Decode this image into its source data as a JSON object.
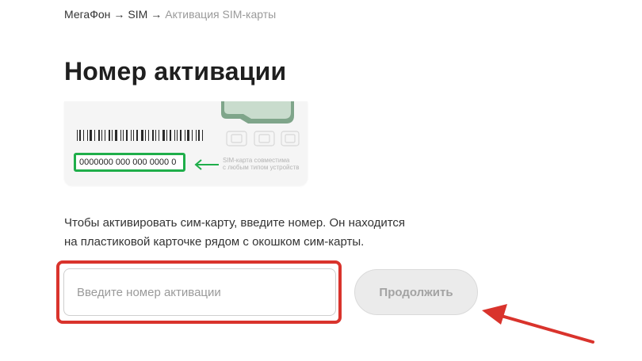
{
  "breadcrumb": {
    "items": [
      "МегаФон",
      "SIM"
    ],
    "separator": "→",
    "current": "Активация SIM-карты"
  },
  "page_title": "Номер активации",
  "sim_card": {
    "activation_number": "0000000 000 000 0000 0",
    "compat_line1": "SIM-карта совместима",
    "compat_line2": "с любым типом устройств"
  },
  "description": {
    "line1": "Чтобы активировать сим-карту, введите номер. Он находится",
    "line2": "на пластиковой карточке рядом с окошком сим-карты."
  },
  "form": {
    "input_placeholder": "Введите номер активации",
    "input_value": "",
    "continue_label": "Продолжить"
  },
  "colors": {
    "brand_green": "#1fae4a",
    "annotation_red": "#d9332c",
    "button_disabled_bg": "#ebebeb",
    "button_disabled_text": "#a3a3a3"
  }
}
